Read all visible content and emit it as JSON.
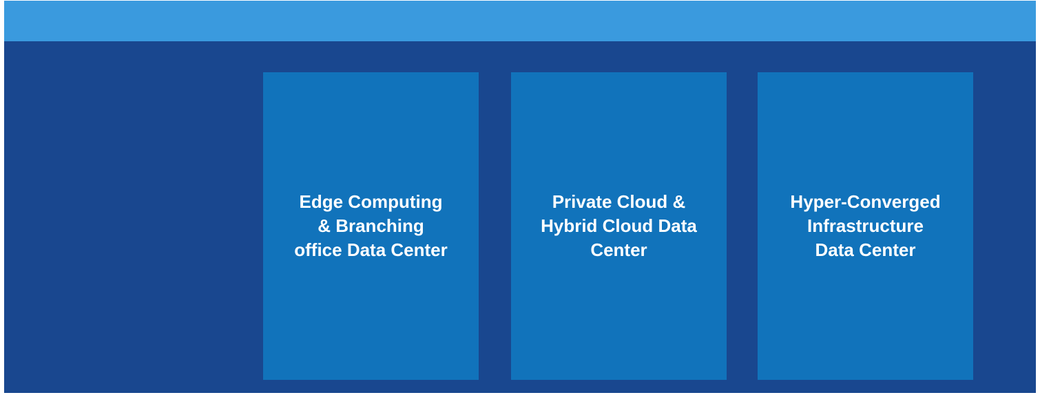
{
  "colors": {
    "background": "#19478f",
    "top_band": "#3a9ade",
    "panel": "#1173bb",
    "text": "#ffffff"
  },
  "panels": [
    {
      "label_lines": [
        "Edge Computing",
        "& Branching",
        "office Data Center"
      ]
    },
    {
      "label_lines": [
        "Private Cloud &",
        "Hybrid Cloud Data",
        "Center"
      ]
    },
    {
      "label_lines": [
        "Hyper-Converged",
        "Infrastructure",
        "Data Center"
      ]
    }
  ]
}
